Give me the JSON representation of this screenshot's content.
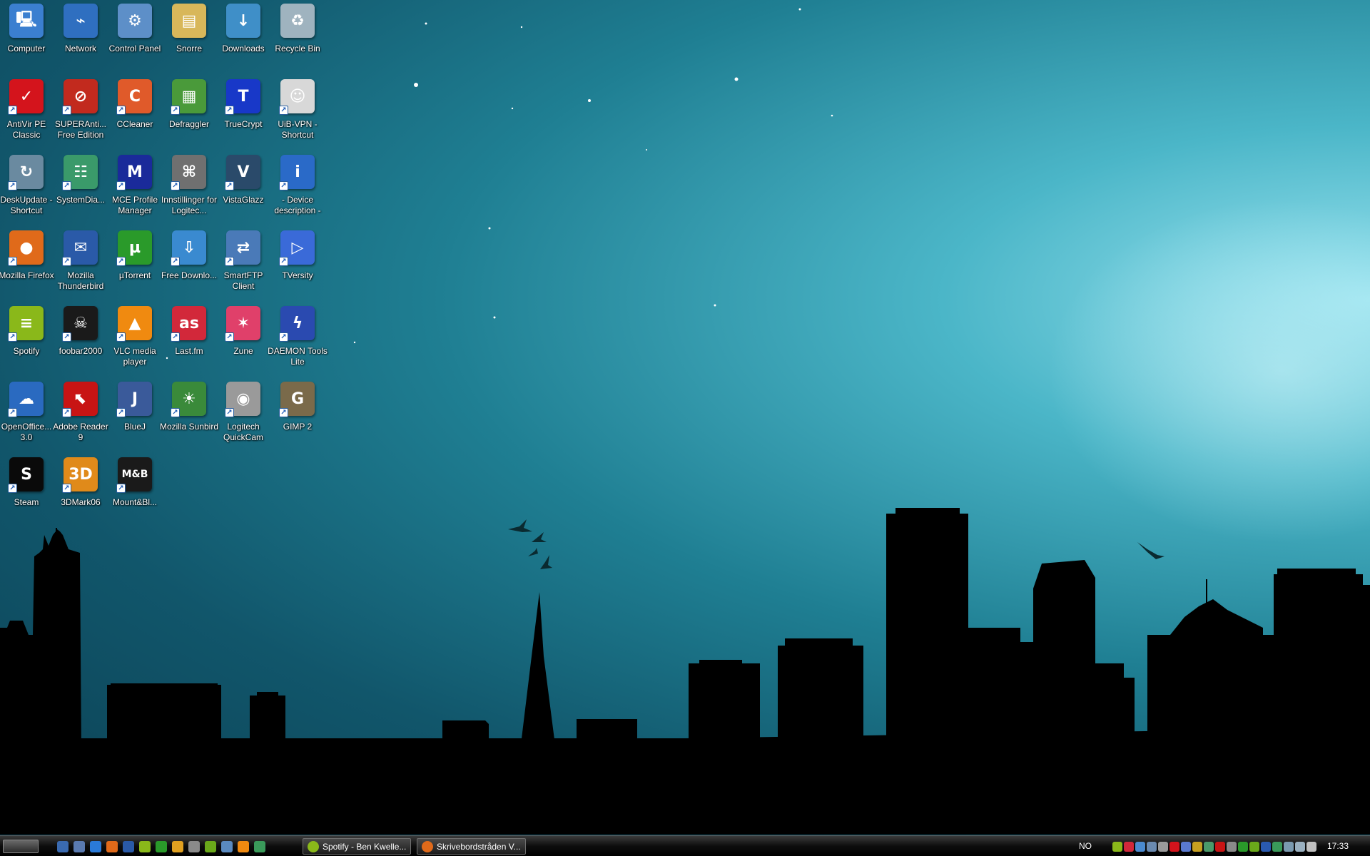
{
  "desktop": {
    "icons": [
      {
        "label": "Computer",
        "icon": "computer-icon",
        "color": "#3b7fd0"
      },
      {
        "label": "Network",
        "icon": "network-icon",
        "color": "#2f6fc0"
      },
      {
        "label": "Control Panel",
        "icon": "control-panel-icon",
        "color": "#5d8fc8"
      },
      {
        "label": "Snorre",
        "icon": "user-folder-icon",
        "color": "#d8b75a"
      },
      {
        "label": "Downloads",
        "icon": "downloads-folder-icon",
        "color": "#3f8fc8"
      },
      {
        "label": "Recycle Bin",
        "icon": "recycle-bin-icon",
        "color": "#9fb3bf"
      },
      {
        "label": "AntiVir PE Classic",
        "icon": "antivir-icon",
        "color": "#d4141c"
      },
      {
        "label": "SUPERAnti... Free Edition",
        "icon": "superantispyware-icon",
        "color": "#c22a1e"
      },
      {
        "label": "CCleaner",
        "icon": "ccleaner-icon",
        "color": "#e05a2a"
      },
      {
        "label": "Defraggler",
        "icon": "defraggler-icon",
        "color": "#4a9a3a"
      },
      {
        "label": "TrueCrypt",
        "icon": "truecrypt-icon",
        "color": "#1838c8"
      },
      {
        "label": "UiB-VPN - Shortcut",
        "icon": "vpn-icon",
        "color": "#d8d8d8"
      },
      {
        "label": "DeskUpdate - Shortcut",
        "icon": "deskupdate-icon",
        "color": "#6a8aa0"
      },
      {
        "label": "SystemDia...",
        "icon": "system-diagnostics-icon",
        "color": "#3a9a6a"
      },
      {
        "label": "MCE Profile Manager",
        "icon": "mce-profile-manager-icon",
        "color": "#1a2a9a"
      },
      {
        "label": "Innstillinger for Logitec...",
        "icon": "logitech-settings-icon",
        "color": "#707070"
      },
      {
        "label": "VistaGlazz",
        "icon": "vistaglazz-icon",
        "color": "#2a4a6a"
      },
      {
        "label": "- Device description -",
        "icon": "info-icon",
        "color": "#2a6ac8"
      },
      {
        "label": "Mozilla Firefox",
        "icon": "firefox-icon",
        "color": "#e06a1a"
      },
      {
        "label": "Mozilla Thunderbird",
        "icon": "thunderbird-icon",
        "color": "#2a5aa8"
      },
      {
        "label": "µTorrent",
        "icon": "utorrent-icon",
        "color": "#2a9a2a"
      },
      {
        "label": "Free Downlo...",
        "icon": "free-download-manager-icon",
        "color": "#3a8ad0"
      },
      {
        "label": "SmartFTP Client",
        "icon": "smartftp-icon",
        "color": "#4a7ab8"
      },
      {
        "label": "TVersity",
        "icon": "tversity-icon",
        "color": "#3a6ad8"
      },
      {
        "label": "Spotify",
        "icon": "spotify-icon",
        "color": "#8ab81a"
      },
      {
        "label": "foobar2000",
        "icon": "foobar2000-icon",
        "color": "#1a1a1a"
      },
      {
        "label": "VLC media player",
        "icon": "vlc-icon",
        "color": "#f08a10"
      },
      {
        "label": "Last.fm",
        "icon": "lastfm-icon",
        "color": "#d2283a"
      },
      {
        "label": "Zune",
        "icon": "zune-icon",
        "color": "#e0406a"
      },
      {
        "label": "DAEMON Tools Lite",
        "icon": "daemon-tools-icon",
        "color": "#2a4ab0"
      },
      {
        "label": "OpenOffice... 3.0",
        "icon": "openoffice-icon",
        "color": "#2a6ac0"
      },
      {
        "label": "Adobe Reader 9",
        "icon": "adobe-reader-icon",
        "color": "#c81414"
      },
      {
        "label": "BlueJ",
        "icon": "bluej-icon",
        "color": "#3a5a9a"
      },
      {
        "label": "Mozilla Sunbird",
        "icon": "sunbird-icon",
        "color": "#3a8a3a"
      },
      {
        "label": "Logitech QuickCam",
        "icon": "quickcam-icon",
        "color": "#9a9a9a"
      },
      {
        "label": "GIMP 2",
        "icon": "gimp-icon",
        "color": "#7a6a4a"
      },
      {
        "label": "Steam",
        "icon": "steam-icon",
        "color": "#0a0a0a"
      },
      {
        "label": "3DMark06",
        "icon": "3dmark06-icon",
        "color": "#e08a1a"
      },
      {
        "label": "Mount&Bl...",
        "icon": "mount-and-blade-icon",
        "color": "#1a1a1a"
      }
    ]
  },
  "taskbar": {
    "quick_launch": [
      {
        "icon": "show-desktop-icon",
        "color": "#3a6ab0"
      },
      {
        "icon": "switch-windows-icon",
        "color": "#5a7ab0"
      },
      {
        "icon": "internet-explorer-icon",
        "color": "#2a7ad8"
      },
      {
        "icon": "firefox-icon",
        "color": "#e06a1a"
      },
      {
        "icon": "thunderbird-icon",
        "color": "#2a5aa8"
      },
      {
        "icon": "spotify-icon",
        "color": "#8ab81a"
      },
      {
        "icon": "utorrent-icon",
        "color": "#2a9a2a"
      },
      {
        "icon": "media-player-icon",
        "color": "#e0a020"
      },
      {
        "icon": "foobar2000-icon",
        "color": "#8a8a8a"
      },
      {
        "icon": "spotify-icon",
        "color": "#6aa81a"
      },
      {
        "icon": "network-icon",
        "color": "#5a8ac0"
      },
      {
        "icon": "vlc-icon",
        "color": "#f08a10"
      },
      {
        "icon": "smartftp-icon",
        "color": "#3a9a5a"
      }
    ],
    "windows": [
      {
        "title": "Spotify - Ben Kwelle...",
        "icon": "spotify-icon",
        "color": "#8ab81a"
      },
      {
        "title": "Skrivebordstråden V...",
        "icon": "firefox-icon",
        "color": "#e06a1a"
      }
    ],
    "language": "NO",
    "tray_icons": [
      {
        "icon": "spotify-tray-icon",
        "color": "#8ab81a"
      },
      {
        "icon": "lastfm-tray-icon",
        "color": "#d2283a"
      },
      {
        "icon": "messenger-tray-icon",
        "color": "#4a8ad0"
      },
      {
        "icon": "network-tray-icon",
        "color": "#6a8ab0"
      },
      {
        "icon": "disk-tray-icon",
        "color": "#9a9a9a"
      },
      {
        "icon": "antivir-tray-icon",
        "color": "#d4141c"
      },
      {
        "icon": "daemon-tray-icon",
        "color": "#5a7ad0"
      },
      {
        "icon": "shield-tray-icon",
        "color": "#c8a020"
      },
      {
        "icon": "hardware-tray-icon",
        "color": "#4a9a6a"
      },
      {
        "icon": "adobe-tray-icon",
        "color": "#c81414"
      },
      {
        "icon": "monitor-tray-icon",
        "color": "#8a8a8a"
      },
      {
        "icon": "utorrent-tray-icon",
        "color": "#2a9a2a"
      },
      {
        "icon": "spotify-tray-icon",
        "color": "#6aa81a"
      },
      {
        "icon": "display-tray-icon",
        "color": "#2a5ab0"
      },
      {
        "icon": "download-tray-icon",
        "color": "#3a9a5a"
      },
      {
        "icon": "safely-remove-tray-icon",
        "color": "#7a9ab0"
      },
      {
        "icon": "network-status-tray-icon",
        "color": "#9ab0c0"
      },
      {
        "icon": "volume-tray-icon",
        "color": "#c0c0c0"
      }
    ],
    "clock": "17:33"
  }
}
